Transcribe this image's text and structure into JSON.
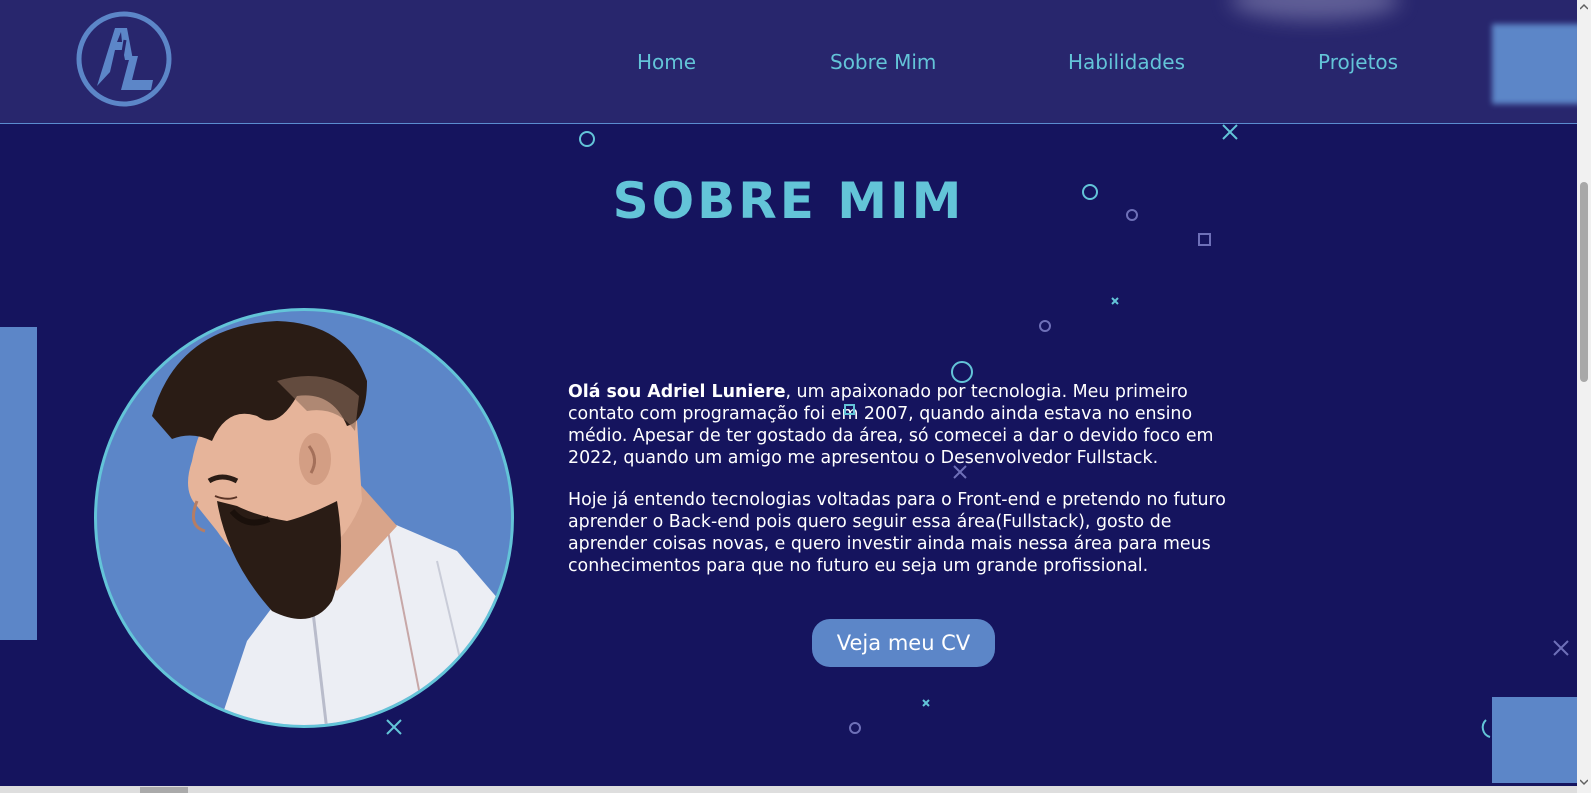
{
  "header": {
    "logo_text": "AL",
    "nav": [
      {
        "label": "Home"
      },
      {
        "label": "Sobre Mim"
      },
      {
        "label": "Habilidades"
      },
      {
        "label": "Projetos"
      }
    ]
  },
  "about": {
    "title": "SOBRE MIM",
    "intro_bold": "Olá sou Adriel Luniere",
    "paragraph1_rest": ", um apaixonado por tecnologia. Meu primeiro contato com programação foi em 2007, quando ainda estava no ensino médio. Apesar de ter gostado da área, só comecei a dar o devido foco em 2022, quando um amigo me apresentou o Desenvolvedor Fullstack.",
    "paragraph2": "Hoje já entendo tecnologias voltadas para o Front-end e pretendo no futuro aprender o Back-end pois quero seguir essa área(Fullstack), gosto de aprender coisas novas, e quero investir ainda mais nessa área para meus conhecimentos para que no futuro eu seja um grande profissional.",
    "cv_button": "Veja meu CV",
    "avatar": "portrait-illustration"
  },
  "colors": {
    "background": "#15145e",
    "header": "#28266d",
    "accent": "#63c4d8",
    "block": "#5c86c8"
  },
  "icons": [
    "logo-icon",
    "circle-deco-icon",
    "cross-deco-icon",
    "square-deco-icon"
  ]
}
